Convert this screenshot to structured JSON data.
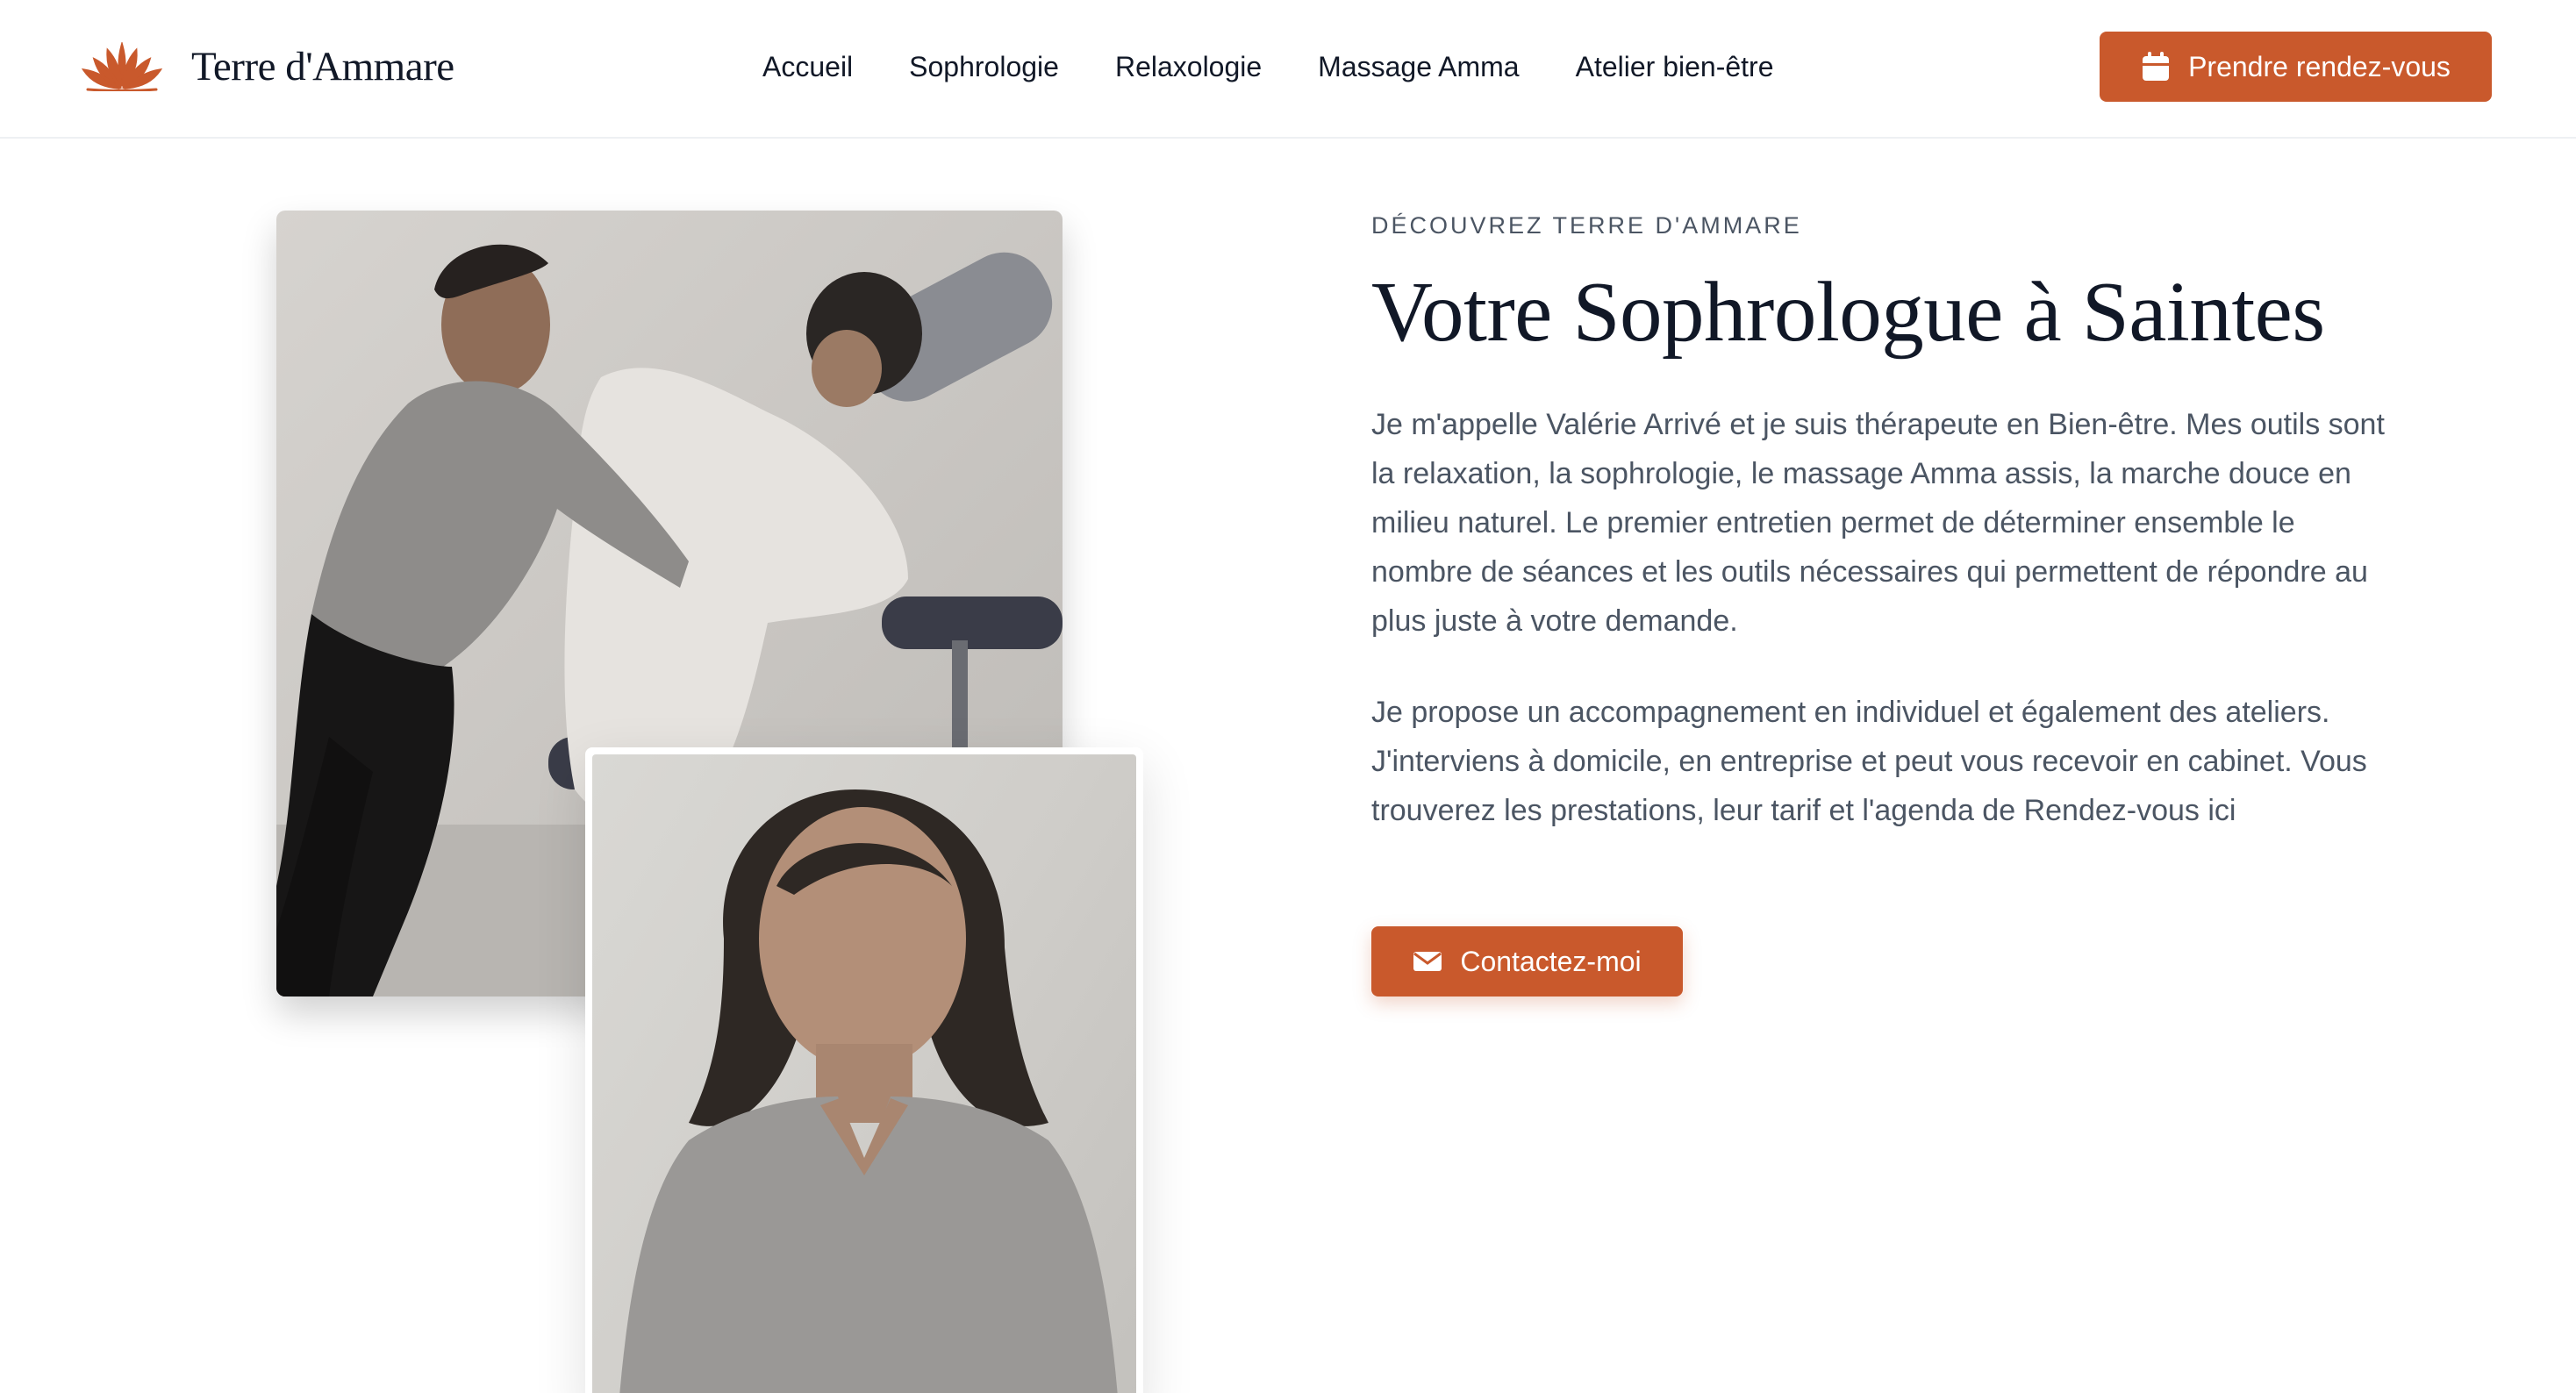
{
  "brand": {
    "name": "Terre d'Ammare",
    "logo_icon": "lotus-icon",
    "accent_color": "#c9592c"
  },
  "nav": {
    "items": [
      {
        "label": "Accueil"
      },
      {
        "label": "Sophrologie"
      },
      {
        "label": "Relaxologie"
      },
      {
        "label": "Massage Amma"
      },
      {
        "label": "Atelier bien-être"
      }
    ]
  },
  "header_cta": {
    "label": "Prendre rendez-vous",
    "icon": "calendar-icon"
  },
  "hero": {
    "kicker": "DÉCOUVREZ TERRE D'AMMARE",
    "title": "Votre Sophrologue à Saintes",
    "paragraphs": [
      "Je m'appelle Valérie Arrivé et je suis thérapeute en Bien-être. Mes outils sont la relaxation, la sophrologie, le massage Amma assis, la marche douce en milieu naturel. Le premier entretien permet de déterminer ensemble le nombre de séances et les outils nécessaires qui permettent de répondre au plus juste à votre demande.",
      "Je propose un accompagnement en individuel et également des ateliers. J'interviens à domicile, en entreprise et peut vous recevoir en cabinet. Vous trouverez les prestations, leur tarif et l'agenda de Rendez-vous ici"
    ],
    "contact_button": {
      "label": "Contactez-moi",
      "icon": "envelope-icon"
    }
  }
}
